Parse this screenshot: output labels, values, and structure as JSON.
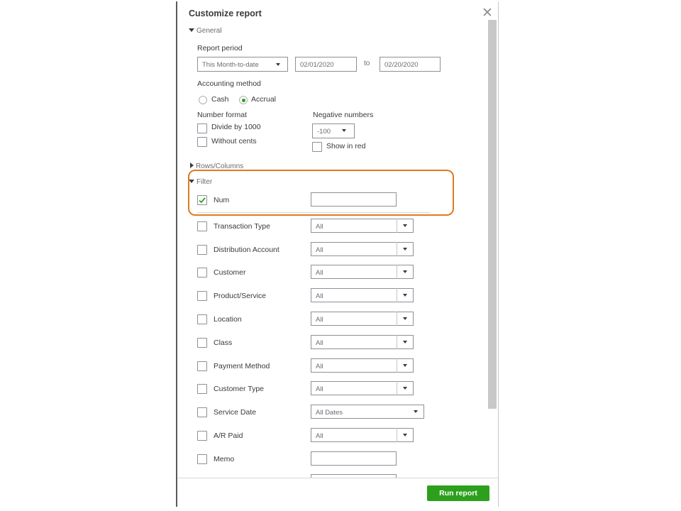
{
  "dialog": {
    "title": "Customize report",
    "close_glyph": "✕",
    "run_button_label": "Run report"
  },
  "general": {
    "section_label": "General",
    "report_period_label": "Report period",
    "report_period_value": "This Month-to-date",
    "date_from": "02/01/2020",
    "to_label": "to",
    "date_to": "02/20/2020",
    "accounting_method_label": "Accounting method",
    "cash_label": "Cash",
    "accrual_label": "Accrual",
    "selected_method": "Accrual",
    "number_format_label": "Number format",
    "divide_label": "Divide by 1000",
    "without_cents_label": "Without cents",
    "negative_numbers_label": "Negative numbers",
    "negative_value": "-100",
    "show_in_red_label": "Show in red"
  },
  "rows_columns": {
    "section_label": "Rows/Columns"
  },
  "filter": {
    "section_label": "Filter",
    "items": [
      {
        "label": "Num",
        "checked": true,
        "kind": "text",
        "value": ""
      },
      {
        "label": "Transaction Type",
        "checked": false,
        "kind": "select",
        "value": "All"
      },
      {
        "label": "Distribution Account",
        "checked": false,
        "kind": "select",
        "value": "All"
      },
      {
        "label": "Customer",
        "checked": false,
        "kind": "select",
        "value": "All"
      },
      {
        "label": "Product/Service",
        "checked": false,
        "kind": "select",
        "value": "All"
      },
      {
        "label": "Location",
        "checked": false,
        "kind": "select",
        "value": "All"
      },
      {
        "label": "Class",
        "checked": false,
        "kind": "select",
        "value": "All"
      },
      {
        "label": "Payment Method",
        "checked": false,
        "kind": "select",
        "value": "All"
      },
      {
        "label": "Customer Type",
        "checked": false,
        "kind": "select",
        "value": "All"
      },
      {
        "label": "Service Date",
        "checked": false,
        "kind": "select-wide",
        "value": "All Dates"
      },
      {
        "label": "A/R Paid",
        "checked": false,
        "kind": "select",
        "value": "All"
      },
      {
        "label": "Memo",
        "checked": false,
        "kind": "text",
        "value": ""
      }
    ]
  },
  "colors": {
    "accent_green": "#2ca01c",
    "highlight_orange": "#e07b1f"
  }
}
